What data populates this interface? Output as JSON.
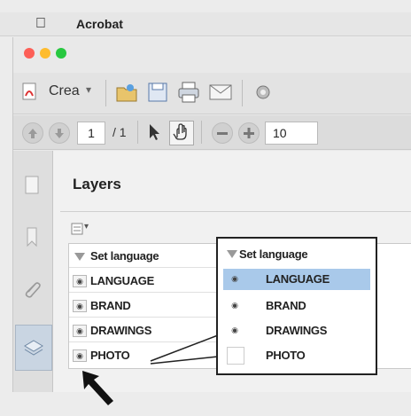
{
  "menubar": {
    "app_name": "Acrobat"
  },
  "toolbar": {
    "create_label": "Crea",
    "create_dropdown": "▾"
  },
  "navbar": {
    "page_current": "1",
    "page_total": "/ 1",
    "zoom": "10"
  },
  "panel": {
    "title": "Layers",
    "options_glyph": "▾"
  },
  "layers": {
    "group": "Set language",
    "items": [
      "LANGUAGE",
      "BRAND",
      "DRAWINGS",
      "PHOTO"
    ]
  },
  "popup": {
    "group": "Set language",
    "items": [
      "LANGUAGE",
      "BRAND",
      "DRAWINGS",
      "PHOTO"
    ],
    "highlighted_index": 0,
    "highlight_color": "#a9c9ea"
  },
  "colors": {
    "light_red": "#fd5f57",
    "light_yellow": "#febc2e",
    "light_green": "#28c840"
  }
}
